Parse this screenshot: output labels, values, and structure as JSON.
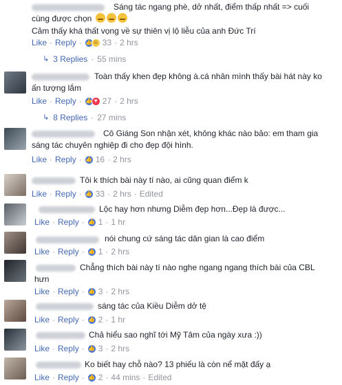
{
  "actions": {
    "like": "Like",
    "reply": "Reply",
    "sep": "·",
    "edited": "Edited"
  },
  "reply_icon": "reply-arrow-icon",
  "comments": [
    {
      "lines": [
        "Sáng tác ngang phè, dở nhất, điểm thấp nhất => cuối",
        "cùng được chọn"
      ],
      "emoji": "unamused-face-icon",
      "line2": "Cảm thấy khá thất vọng về sự thiên vị lộ liễu của anh Đức Trí",
      "reactions": [
        "like",
        "haha"
      ],
      "count": "33",
      "time": "2 hrs",
      "replies": {
        "label": "3 Replies",
        "time": "55 mins"
      }
    },
    {
      "lines": [
        "Toàn thấy khen đẹp không à.cá nhân mình thấy bài hát này ko",
        "ấn tượng lắm"
      ],
      "reactions": [
        "like",
        "love"
      ],
      "count": "27",
      "time": "2 hrs",
      "replies": {
        "label": "8 Replies",
        "time": "27 mins"
      }
    },
    {
      "lines": [
        "Cô Giáng Son nhận xét, không khác nào bảo: em tham gia",
        "sáng tác chuyên nghiệp đi cho đẹp đội hình."
      ],
      "reactions": [
        "like"
      ],
      "count": "16",
      "time": "2 hrs"
    },
    {
      "lines": [
        "Tôi k thích bài này tí nào, ai cũng quan điểm k"
      ],
      "reactions": [
        "like"
      ],
      "count": "33",
      "time": "2 hrs",
      "edited": true
    },
    {
      "lines": [
        "Lộc hay hơn nhưng Diễm đẹp hơn...Đẹp là được..."
      ],
      "reactions": [
        "like"
      ],
      "count": "1",
      "time": "1 hr"
    },
    {
      "lines": [
        "nói chung cứ sáng tác dân gian là cao điểm"
      ],
      "reactions": [
        "like"
      ],
      "count": "1",
      "time": "2 hrs"
    },
    {
      "lines": [
        "Chẳng thích bài này tí nào nghe ngang ngang thích bài của CBL",
        "hưn"
      ],
      "reactions": [
        "like"
      ],
      "count": "3",
      "time": "2 hrs"
    },
    {
      "lines": [
        "sáng tác của Kiều Diễm dở tệ"
      ],
      "reactions": [
        "like"
      ],
      "count": "2",
      "time": "1 hr"
    },
    {
      "lines": [
        "Chả hiểu sao nghĩ tới Mỹ Tâm của ngày xưa :))"
      ],
      "reactions": [
        "like"
      ],
      "count": "3",
      "time": "2 hrs"
    },
    {
      "lines": [
        "Ko biết hay chỗ nào? 13 phiếu là còn nể mặt đấy ạ"
      ],
      "reactions": [
        "like"
      ],
      "count": "2",
      "time": "44 mins",
      "edited": true
    }
  ]
}
